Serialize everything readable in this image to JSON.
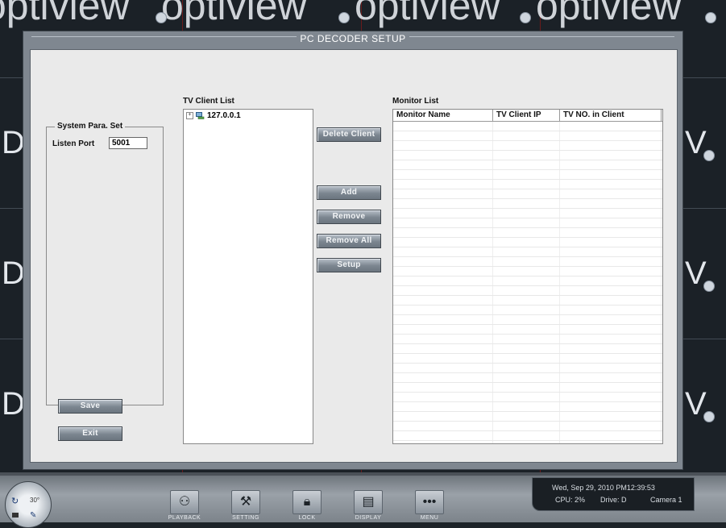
{
  "background": {
    "watermark": "optiview"
  },
  "dialog": {
    "title": "PC DECODER SETUP",
    "system_group": {
      "title": "System Para. Set",
      "listen_port_label": "Listen Port",
      "listen_port_value": "5001"
    },
    "tv_client_list": {
      "label": "TV Client List",
      "items": [
        "127.0.0.1"
      ]
    },
    "monitor_list": {
      "label": "Monitor List",
      "columns": [
        "Monitor Name",
        "TV Client IP",
        "TV NO. in Client"
      ],
      "rows": []
    },
    "buttons": {
      "delete_client": "Delete Client",
      "add": "Add",
      "remove": "Remove",
      "remove_all": "Remove All",
      "setup": "Setup",
      "save": "Save",
      "exit": "Exit"
    }
  },
  "taskbar": {
    "dial_value": "30°",
    "buttons": [
      "PLAYBACK",
      "SETTING",
      "LOCK",
      "DISPLAY",
      "MENU"
    ],
    "status": {
      "datetime": "Wed, Sep 29, 2010   PM12:39:53",
      "cpu": "CPU: 2%",
      "drive": "Drive: D",
      "camera": "Camera 1"
    }
  },
  "colors": {
    "dialog_frame": "#7f8790",
    "dialog_body": "#eaeaea",
    "button": "#7b858f",
    "background": "#1b2127"
  }
}
